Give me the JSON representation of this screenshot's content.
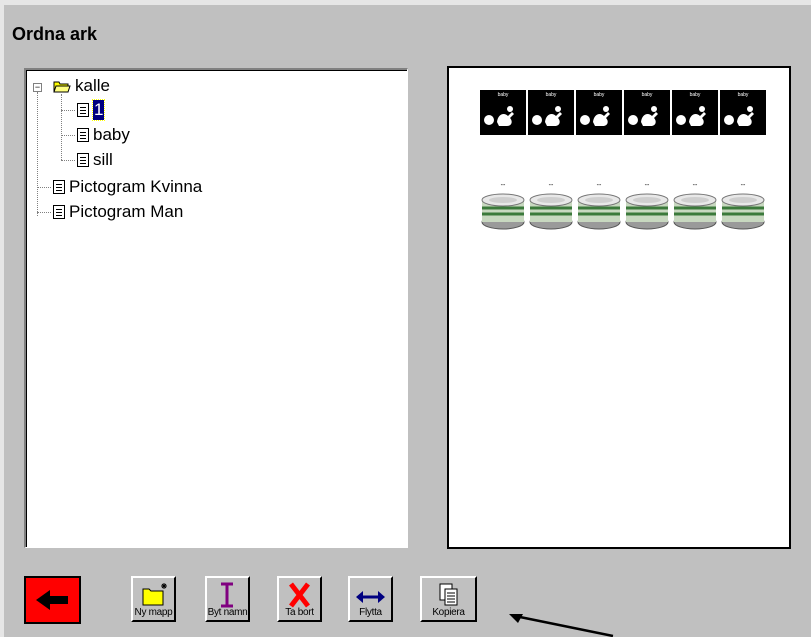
{
  "title": "Ordna ark",
  "tree": {
    "folder": "kalle",
    "folder_items": [
      "1",
      "baby",
      "sill"
    ],
    "root_items": [
      "Pictogram Kvinna",
      "Pictogram Man"
    ],
    "expander_symbol": "−"
  },
  "preview": {
    "baby_label": "baby",
    "sill_label": "--",
    "baby_count": 6,
    "sill_count": 6
  },
  "toolbar": {
    "new_folder_label": "Ny mapp",
    "rename_label": "Byt namn",
    "delete_label": "Ta bort",
    "move_label": "Flytta",
    "copy_label": "Kopiera"
  },
  "colors": {
    "background": "#c0c0c0",
    "selection": "#000080",
    "back_button": "#ff0000",
    "delete_icon": "#ff0000",
    "rename_icon": "#800080",
    "move_icon": "#000080",
    "folder_icon": "#ffff00"
  },
  "icons": {
    "back": "left-arrow-icon",
    "new_folder": "new-folder-icon",
    "rename": "text-cursor-icon",
    "delete": "x-icon",
    "move": "double-arrow-icon",
    "copy": "copy-icon"
  }
}
